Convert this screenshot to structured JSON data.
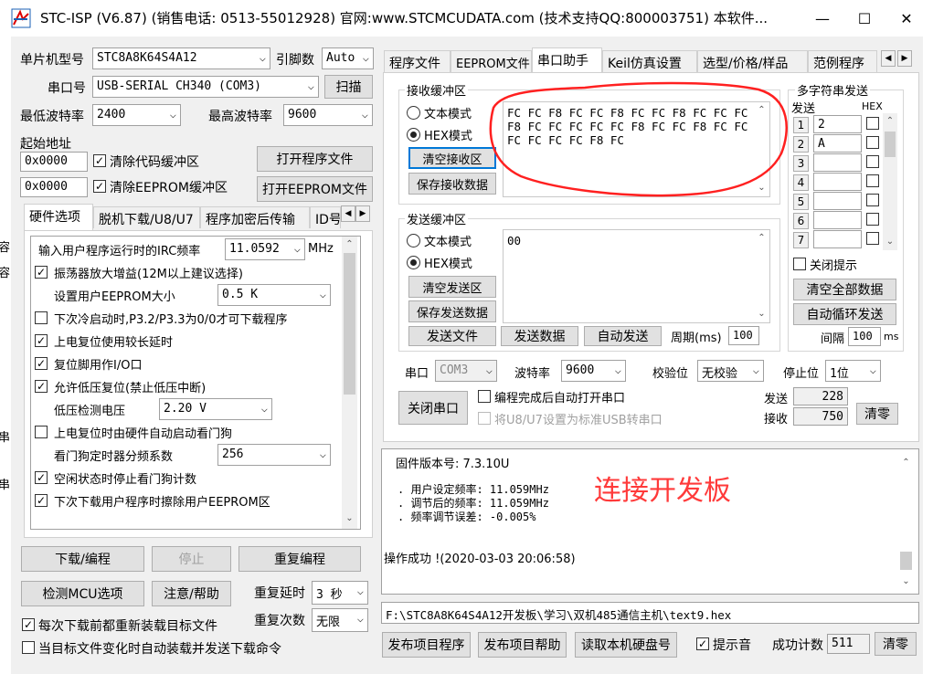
{
  "window": {
    "title": "STC-ISP (V6.87) (销售电话: 0513-55012928) 官网:www.STCMCUDATA.com  (技术支持QQ:800003751) 本软件...",
    "minimize": "—",
    "maximize": "☐",
    "close": "✕"
  },
  "left": {
    "mcu_type_label": "单片机型号",
    "mcu_type_value": "STC8A8K64S4A12",
    "pins_label": "引脚数",
    "pins_value": "Auto",
    "port_label": "串口号",
    "port_value": "USB-SERIAL CH340 (COM3)",
    "scan_button": "扫描",
    "min_baud_label": "最低波特率",
    "min_baud_value": "2400",
    "max_baud_label": "最高波特率",
    "max_baud_value": "9600",
    "start_addr_label": "起始地址",
    "addr1": "0x0000",
    "clear_code_label": "清除代码缓冲区",
    "open_program_button": "打开程序文件",
    "addr2": "0x0000",
    "clear_eeprom_label": "清除EEPROM缓冲区",
    "open_eeprom_button": "打开EEPROM文件",
    "tabs": [
      "硬件选项",
      "脱机下载/U8/U7",
      "程序加密后传输",
      "ID号"
    ],
    "hw": {
      "irc_label": "输入用户程序运行时的IRC频率",
      "irc_value": "11.0592",
      "irc_unit": "MHz",
      "osc_gain": "振荡器放大增益(12M以上建议选择)",
      "eeprom_size_label": "设置用户EEPROM大小",
      "eeprom_size_value": "0.5 K",
      "cold_start": "下次冷启动时,P3.2/P3.3为0/0才可下载程序",
      "por_delay": "上电复位使用较长延时",
      "reset_io": "复位脚用作I/O口",
      "lvr": "允许低压复位(禁止低压中断)",
      "lvd_label": "低压检测电压",
      "lvd_value": "2.20 V",
      "wdt_auto": "上电复位时由硬件自动启动看门狗",
      "wdt_div_label": "看门狗定时器分频系数",
      "wdt_div_value": "256",
      "idle_wdt": "空闲状态时停止看门狗计数",
      "erase_eeprom": "下次下载用户程序时擦除用户EEPROM区"
    },
    "download_button": "下载/编程",
    "stop_button": "停止",
    "reprogram_button": "重复编程",
    "check_mcu_button": "检测MCU选项",
    "help_button": "注意/帮助",
    "retry_delay_label": "重复延时",
    "retry_delay_value": "3 秒",
    "retry_count_label": "重复次数",
    "retry_count_value": "无限",
    "reload_label": "每次下载前都重新装载目标文件",
    "autoload_label": "当目标文件变化时自动装载并发送下载命令"
  },
  "right": {
    "tabs": [
      "程序文件",
      "EEPROM文件",
      "串口助手",
      "Keil仿真设置",
      "选型/价格/样品",
      "范例程序"
    ],
    "recv": {
      "group_label": "接收缓冲区",
      "text_mode": "文本模式",
      "hex_mode": "HEX模式",
      "clear_button": "清空接收区",
      "save_button": "保存接收数据",
      "lines": [
        "FC FC F8 FC FC F8 FC FC F8 FC FC FC",
        "F8 FC FC FC FC FC F8 FC FC F8 FC FC",
        "FC FC FC FC F8 FC"
      ]
    },
    "send": {
      "group_label": "发送缓冲区",
      "text_mode": "文本模式",
      "hex_mode": "HEX模式",
      "clear_button": "清空发送区",
      "save_button": "保存发送数据",
      "content": "00",
      "send_file_button": "发送文件",
      "send_data_button": "发送数据",
      "auto_send_button": "自动发送",
      "period_label": "周期(ms)",
      "period_value": "100"
    },
    "multi": {
      "group_label": "多字符串发送",
      "send_col": "发送",
      "hex_col": "HEX",
      "rows": [
        {
          "num": "1",
          "value": "2"
        },
        {
          "num": "2",
          "value": "A"
        },
        {
          "num": "3",
          "value": ""
        },
        {
          "num": "4",
          "value": ""
        },
        {
          "num": "5",
          "value": ""
        },
        {
          "num": "6",
          "value": ""
        },
        {
          "num": "7",
          "value": ""
        }
      ],
      "close_tip_label": "关闭提示",
      "clear_all_button": "清空全部数据",
      "auto_loop_button": "自动循环发送",
      "interval_label": "间隔",
      "interval_value": "100",
      "interval_unit": "ms"
    },
    "serial": {
      "port_label": "串口",
      "port_value": "COM3",
      "baud_label": "波特率",
      "baud_value": "9600",
      "parity_label": "校验位",
      "parity_value": "无校验",
      "stop_label": "停止位",
      "stop_value": "1位",
      "close_port_button": "关闭串口",
      "auto_open_label": "编程完成后自动打开串口",
      "usb_label": "将U8/U7设置为标准USB转串口",
      "sent_label": "发送",
      "sent_value": "228",
      "recv_label": "接收",
      "recv_value": "750",
      "clear_button": "清零"
    },
    "log": {
      "firmware": "固件版本号: 7.3.10U",
      "lines": [
        ". 用户设定频率: 11.059MHz",
        ". 调节后的频率: 11.059MHz",
        ". 频率调节误差: -0.005%"
      ],
      "success": "操作成功 !(2020-03-03 20:06:58)",
      "annotation": "连接开发板"
    },
    "file_path": "F:\\STC8A8K64S4A12开发板\\学习\\双机485通信主机\\text9.hex",
    "publish_program_button": "发布项目程序",
    "publish_help_button": "发布项目帮助",
    "read_disk_button": "读取本机硬盘号",
    "beep_label": "提示音",
    "success_count_label": "成功计数",
    "success_count_value": "511",
    "success_clear_button": "清零"
  },
  "background_fragments": [
    "容",
    "容",
    "串",
    "串"
  ],
  "colors": {
    "annotation_red": "#ff3a3a",
    "focus_blue": "#0078d7",
    "window_bg": "#f0f0f0"
  }
}
